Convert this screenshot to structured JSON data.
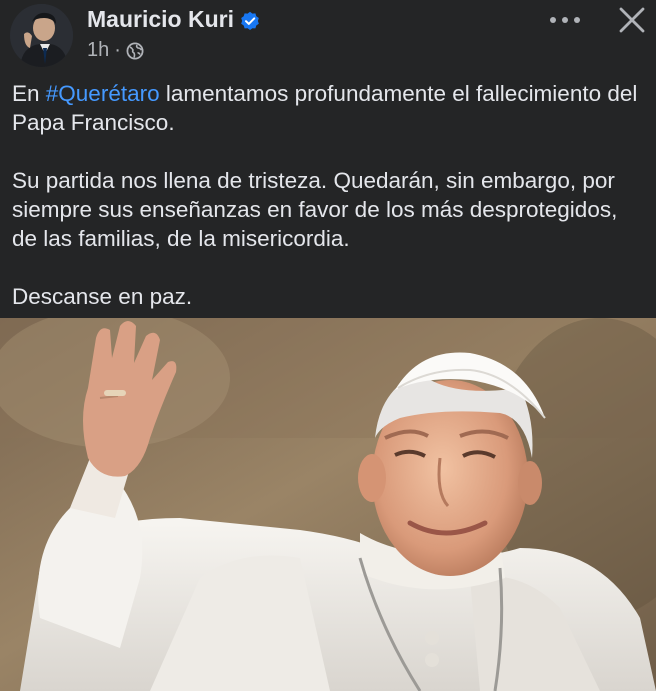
{
  "post": {
    "author": "Mauricio Kuri",
    "time": "1h",
    "separator": "·",
    "verified_icon": "verified-badge-icon",
    "privacy_icon": "globe-icon",
    "paragraphs": [
      {
        "before": "En ",
        "hashtag": "#Querétaro",
        "after": " lamentamos profundamente el fallecimiento del Papa Francisco."
      },
      {
        "text": "Su partida nos llena de tristeza. Quedarán, sin embargo, por siempre sus enseñanzas en favor de los más desprotegidos, de las familias, de la misericordia."
      },
      {
        "text": "Descanse en paz."
      }
    ]
  },
  "colors": {
    "background": "#242526",
    "text": "#e4e6eb",
    "secondary_text": "#b0b3b8",
    "hashtag": "#4599ff",
    "verified": "#1877f2"
  }
}
